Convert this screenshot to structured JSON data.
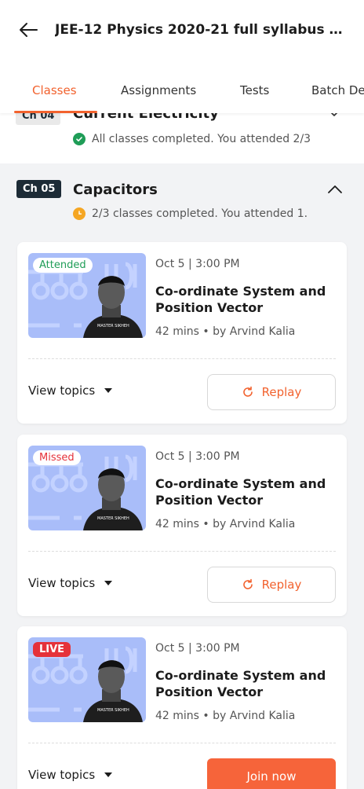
{
  "header": {
    "title": "JEE-12 Physics 2020-21 full syllabus co..."
  },
  "tabs": [
    {
      "label": "Classes",
      "active": true
    },
    {
      "label": "Assignments"
    },
    {
      "label": "Tests"
    },
    {
      "label": "Batch De"
    }
  ],
  "prev_chapter": {
    "chip": "Ch 04",
    "title": "Current Electricity",
    "status": "All classes completed. You attended 2/3"
  },
  "chapter": {
    "chip": "Ch 05",
    "title": "Capacitors",
    "status": "2/3 classes completed. You attended 1."
  },
  "cards": [
    {
      "badge": "Attended",
      "date": "Oct 5 | 3:00 PM",
      "title": "Co-ordinate System and Position Vector",
      "info": "42 mins • by Arvind Kalia",
      "view_topics": "View topics",
      "action": "Replay"
    },
    {
      "badge": "Missed",
      "date": "Oct 5 | 3:00 PM",
      "title": "Co-ordinate System and Position Vector",
      "info": "42 mins • by Arvind Kalia",
      "view_topics": "View topics",
      "action": "Replay"
    },
    {
      "badge": "LIVE",
      "date": "Oct 5 | 3:00 PM",
      "title": "Co-ordinate System and Position Vector",
      "info": "42 mins • by Arvind Kalia",
      "view_topics": "View topics",
      "action": "Join now"
    }
  ],
  "colors": {
    "accent": "#f2622e",
    "attended": "#1f9d57",
    "missed": "#e5323a",
    "live": "#e5323a",
    "pending": "#f5a623",
    "chip_bg": "#1d2b36",
    "thumb_bg": "#a9bdf9"
  },
  "icons": {
    "back": "arrow-left-icon",
    "chevron_up": "chevron-up-icon",
    "chevron_down": "chevron-down-icon",
    "check": "check-circle-icon",
    "clock": "clock-icon",
    "replay": "replay-icon",
    "caret": "caret-down-icon"
  }
}
